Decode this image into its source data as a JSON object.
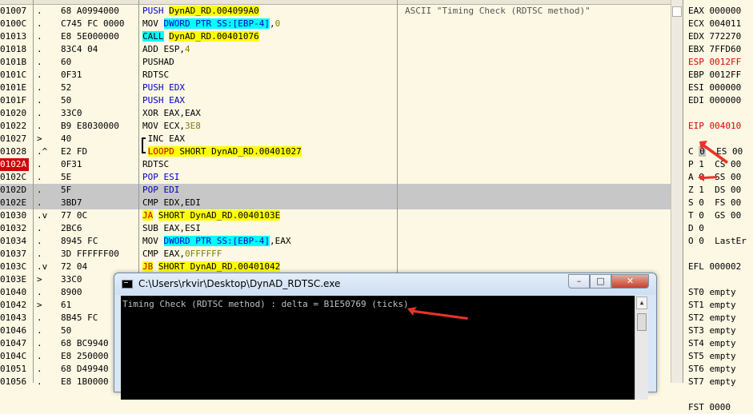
{
  "disasm": {
    "rows": [
      {
        "addr": "01007",
        "mark": ".",
        "bytes": "68 A0994000",
        "asm": [
          {
            "t": "PUSH ",
            "c": "blu"
          },
          {
            "t": "DynAD_RD.004099A0",
            "c": "hl-y"
          }
        ],
        "comment": "ASCII \"Timing Check (RDTSC method)\""
      },
      {
        "addr": "0100C",
        "mark": ".",
        "bytes": "C745 FC 0000",
        "asm": [
          {
            "t": "MOV "
          },
          {
            "t": "DWORD PTR SS:[EBP-4]",
            "c": "hl-c blu"
          },
          {
            "t": ","
          },
          {
            "t": "0",
            "c": "num"
          }
        ]
      },
      {
        "addr": "01013",
        "mark": ".",
        "bytes": "E8 5E000000",
        "asm": [
          {
            "t": "CALL",
            "c": "hl-c"
          },
          {
            "t": " "
          },
          {
            "t": "DynAD_RD.00401076",
            "c": "hl-y"
          }
        ]
      },
      {
        "addr": "01018",
        "mark": ".",
        "bytes": "83C4 04",
        "asm": [
          {
            "t": "ADD ESP,"
          },
          {
            "t": "4",
            "c": "num"
          }
        ]
      },
      {
        "addr": "0101B",
        "mark": ".",
        "bytes": "60",
        "asm": [
          {
            "t": "PUSHAD"
          }
        ]
      },
      {
        "addr": "0101C",
        "mark": ".",
        "bytes": "0F31",
        "asm": [
          {
            "t": "RDTSC"
          }
        ]
      },
      {
        "addr": "0101E",
        "mark": ".",
        "bytes": "52",
        "asm": [
          {
            "t": "PUSH EDX",
            "c": "blu"
          }
        ]
      },
      {
        "addr": "0101F",
        "mark": ".",
        "bytes": "50",
        "asm": [
          {
            "t": "PUSH EAX",
            "c": "blu"
          }
        ]
      },
      {
        "addr": "01020",
        "mark": ".",
        "bytes": "33C0",
        "asm": [
          {
            "t": "XOR EAX,EAX"
          }
        ]
      },
      {
        "addr": "01022",
        "mark": ".",
        "bytes": "B9 E8030000",
        "asm": [
          {
            "t": "MOV ECX,"
          },
          {
            "t": "3E8",
            "c": "num"
          }
        ]
      },
      {
        "addr": "01027",
        "mark": ">",
        "bytes": "40",
        "asm": [
          {
            "t": " INC EAX"
          }
        ]
      },
      {
        "addr": "01028",
        "mark": ".^",
        "bytes": "E2 FD",
        "asm": [
          {
            "t": " "
          },
          {
            "t": "LOOPD",
            "c": "hl-y red-t"
          },
          {
            "t": " SHORT DynAD_RD.00401027",
            "c": "hl-y"
          }
        ]
      },
      {
        "addr": "0102A",
        "mark": ".",
        "bytes": "0F31",
        "asm": [
          {
            "t": "RDTSC"
          }
        ],
        "red": true
      },
      {
        "addr": "0102C",
        "mark": ".",
        "bytes": "5E",
        "asm": [
          {
            "t": "POP ESI",
            "c": "blu"
          }
        ]
      },
      {
        "addr": "0102D",
        "mark": ".",
        "bytes": "5F",
        "asm": [
          {
            "t": "POP EDI",
            "c": "blu"
          }
        ],
        "sel": true
      },
      {
        "addr": "0102E",
        "mark": ".",
        "bytes": "3BD7",
        "asm": [
          {
            "t": "CMP EDX,EDI"
          }
        ],
        "sel": true
      },
      {
        "addr": "01030",
        "mark": ".v",
        "bytes": "77 0C",
        "asm": [
          {
            "t": "JA",
            "c": "hl-y red-t"
          },
          {
            "t": " "
          },
          {
            "t": "SHORT DynAD_RD.0040103E",
            "c": "hl-y"
          }
        ]
      },
      {
        "addr": "01032",
        "mark": ".",
        "bytes": "2BC6",
        "asm": [
          {
            "t": "SUB EAX,ESI"
          }
        ]
      },
      {
        "addr": "01034",
        "mark": ".",
        "bytes": "8945 FC",
        "asm": [
          {
            "t": "MOV "
          },
          {
            "t": "DWORD PTR SS:[EBP-4]",
            "c": "hl-c blu"
          },
          {
            "t": ",EAX"
          }
        ]
      },
      {
        "addr": "01037",
        "mark": ".",
        "bytes": "3D FFFFFF00",
        "asm": [
          {
            "t": "CMP EAX,"
          },
          {
            "t": "0FFFFFF",
            "c": "num"
          }
        ]
      },
      {
        "addr": "0103C",
        "mark": ".v",
        "bytes": "72 04",
        "asm": [
          {
            "t": "JB",
            "c": "hl-y red-t"
          },
          {
            "t": " "
          },
          {
            "t": "SHORT DynAD_RD.00401042",
            "c": "hl-y"
          }
        ]
      },
      {
        "addr": "0103E",
        "mark": ">",
        "bytes": "33C0",
        "asm": []
      },
      {
        "addr": "01040",
        "mark": ".",
        "bytes": "8900",
        "asm": []
      },
      {
        "addr": "01042",
        "mark": ">",
        "bytes": "61",
        "asm": []
      },
      {
        "addr": "01043",
        "mark": ".",
        "bytes": "8B45 FC",
        "asm": []
      },
      {
        "addr": "01046",
        "mark": ".",
        "bytes": "50",
        "asm": []
      },
      {
        "addr": "01047",
        "mark": ".",
        "bytes": "68 BC9940",
        "asm": []
      },
      {
        "addr": "0104C",
        "mark": ".",
        "bytes": "E8 250000",
        "asm": []
      },
      {
        "addr": "01051",
        "mark": ".",
        "bytes": "68 D49940",
        "asm": []
      },
      {
        "addr": "01056",
        "mark": ".",
        "bytes": "E8 1B0000",
        "asm": []
      }
    ]
  },
  "registers": [
    {
      "text": "EAX 000000"
    },
    {
      "text": "ECX 004011"
    },
    {
      "text": "EDX 772270"
    },
    {
      "text": "EBX 7FFD60"
    },
    {
      "text": "ESP 0012FF",
      "red": true
    },
    {
      "text": "EBP 0012FF"
    },
    {
      "text": "ESI 000000"
    },
    {
      "text": "EDI 000000"
    },
    {
      "text": ""
    },
    {
      "text": "EIP 004010",
      "red": true
    },
    {
      "text": ""
    },
    {
      "text": "C 0  ES 00"
    },
    {
      "text": "P 1  CS 00"
    },
    {
      "text": "A 0  SS 00"
    },
    {
      "text": "Z 1  DS 00"
    },
    {
      "text": "S 0  FS 00"
    },
    {
      "text": "T 0  GS 00"
    },
    {
      "text": "D 0"
    },
    {
      "text": "O 0  LastEr"
    },
    {
      "text": ""
    },
    {
      "text": "EFL 000002"
    },
    {
      "text": ""
    },
    {
      "text": "ST0 empty"
    },
    {
      "text": "ST1 empty"
    },
    {
      "text": "ST2 empty"
    },
    {
      "text": "ST3 empty"
    },
    {
      "text": "ST4 empty"
    },
    {
      "text": "ST5 empty"
    },
    {
      "text": "ST6 empty"
    },
    {
      "text": "ST7 empty"
    },
    {
      "text": ""
    },
    {
      "text": "FST 0000"
    }
  ],
  "console": {
    "title": "C:\\Users\\rkvir\\Desktop\\DynAD_RDTSC.exe",
    "output": "Timing Check (RDTSC method) : delta = B1E50769 (ticks)",
    "min_label": "–",
    "max_label": "□",
    "close_label": "✕"
  },
  "colors": {
    "annotation_arrow": "#e8322a",
    "highlight_yellow": "#ffff00",
    "highlight_cyan": "#00ffff"
  }
}
